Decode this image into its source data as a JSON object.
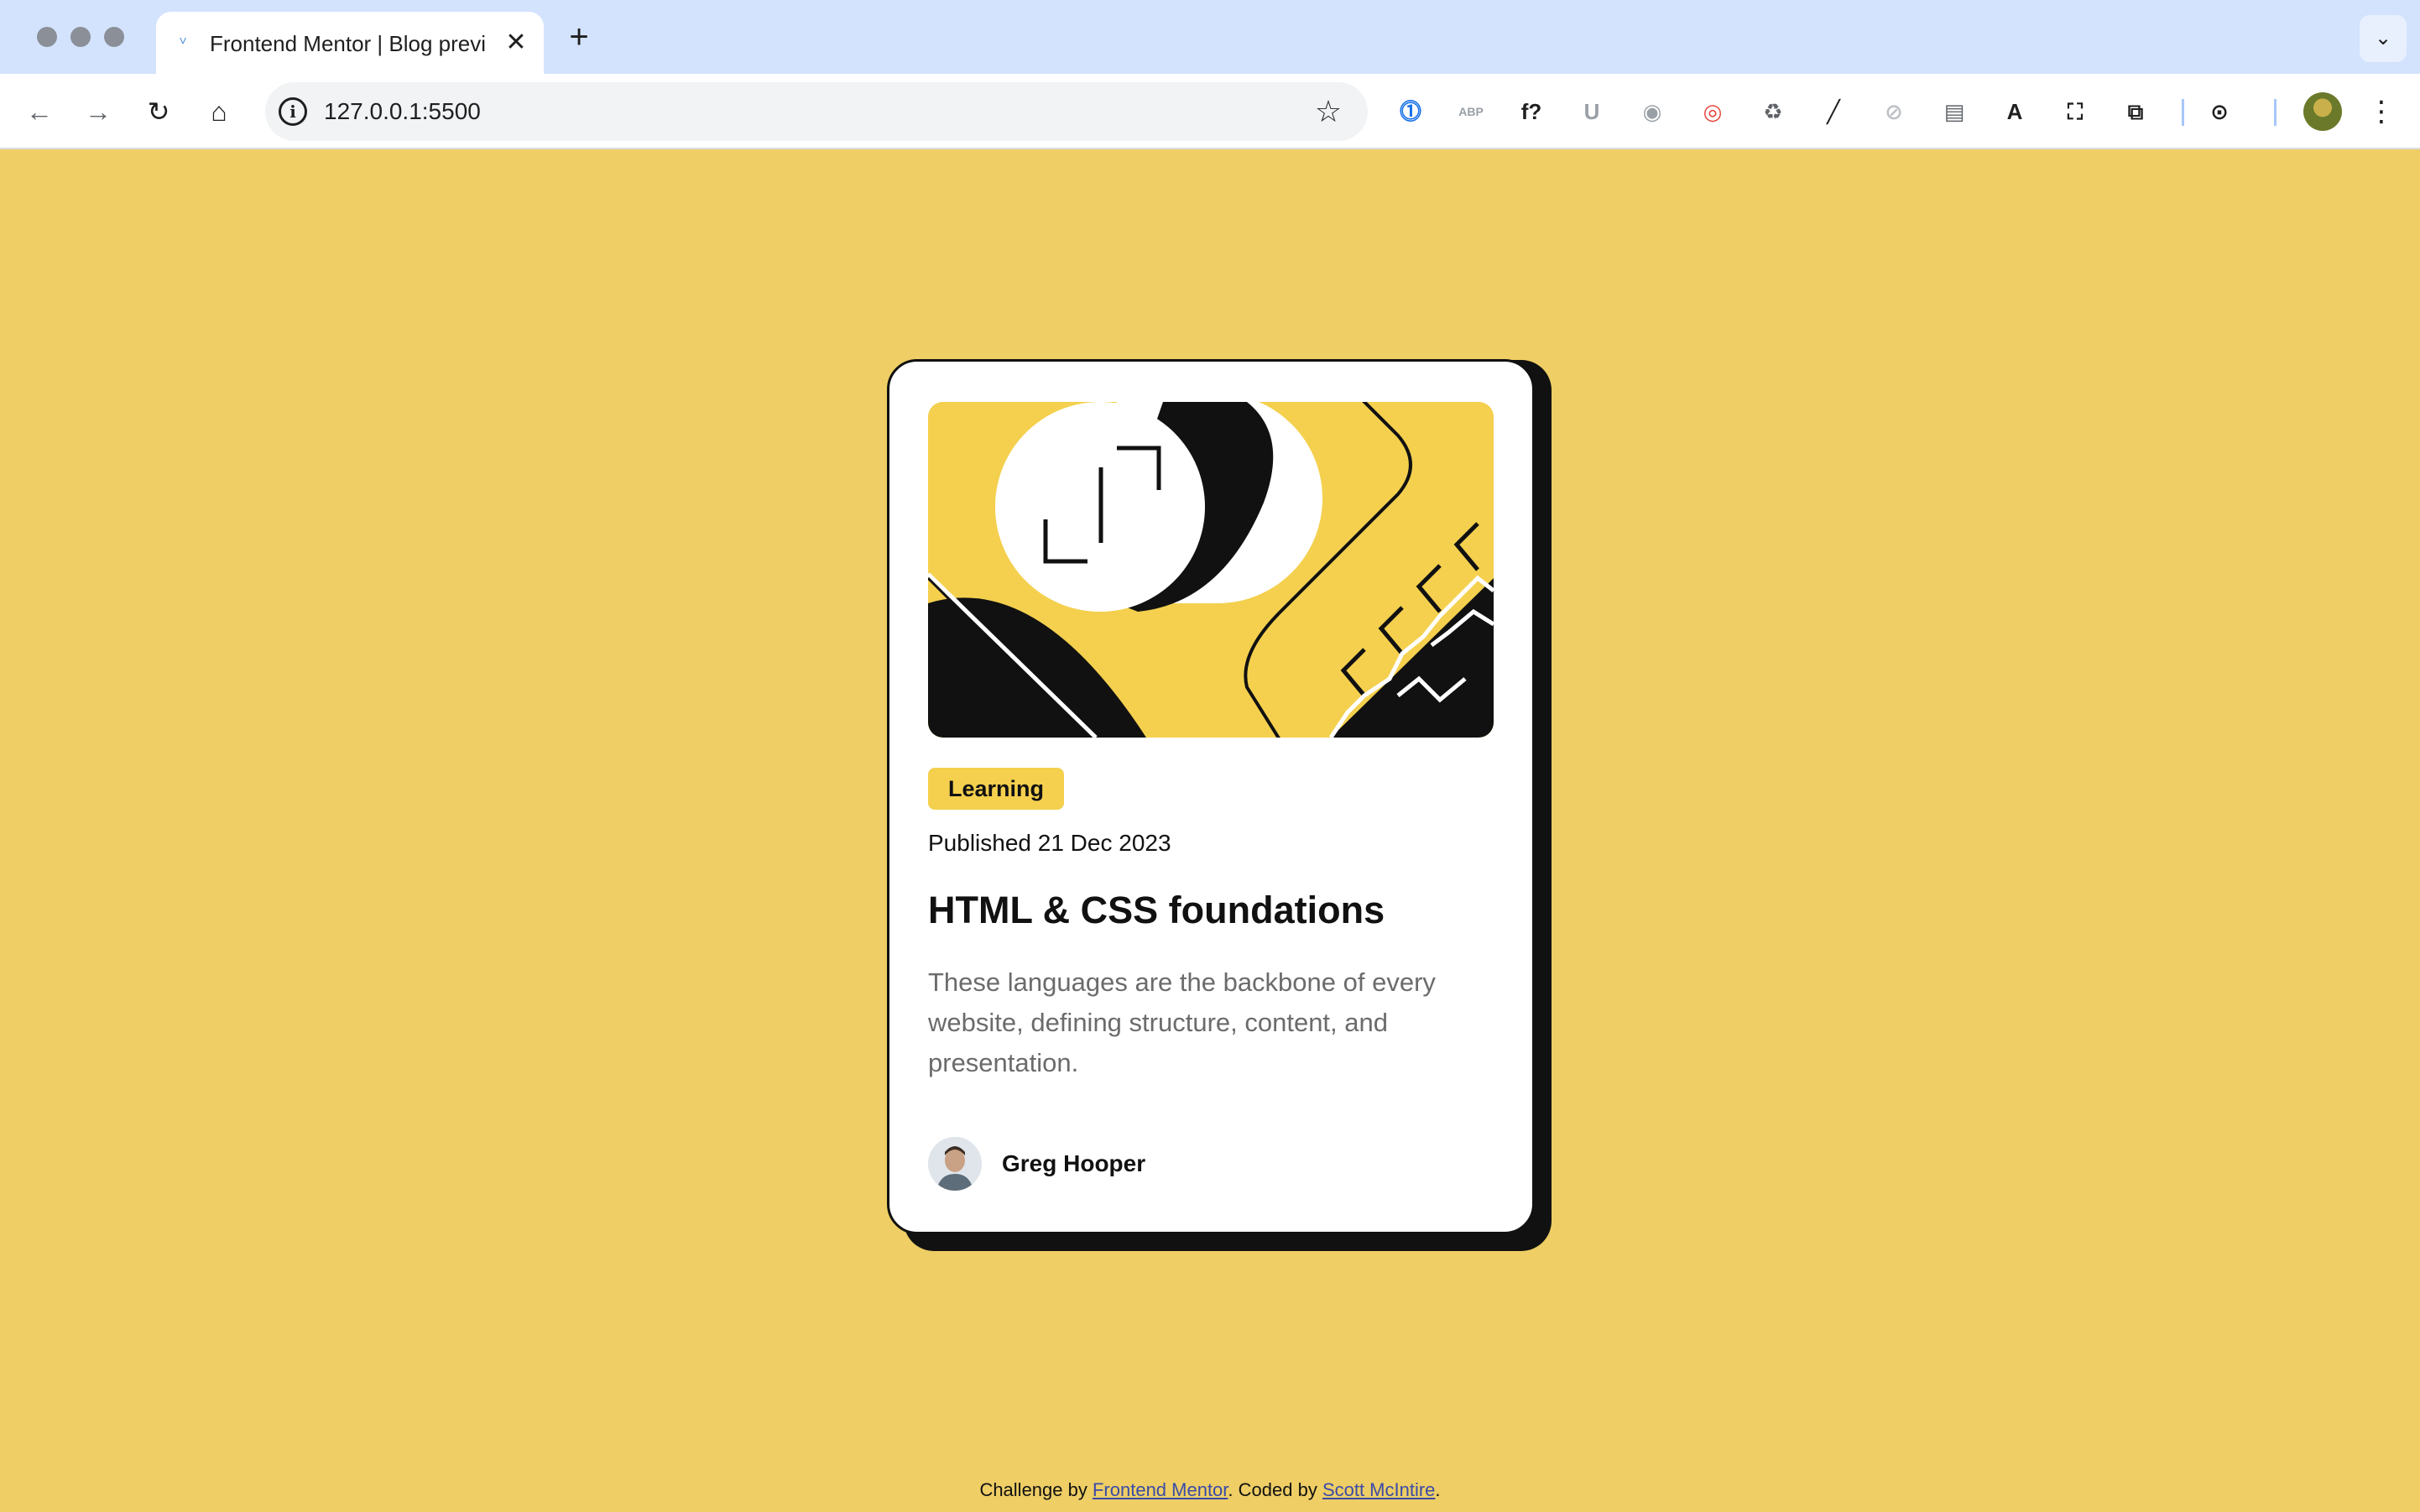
{
  "browser": {
    "tab_title": "Frontend Mentor | Blog preview",
    "url": "127.0.0.1:5500",
    "new_tab_label": "+",
    "extensions": [
      {
        "name": "password-manager-icon",
        "color": "#1a73e8",
        "glyph": "⓵"
      },
      {
        "name": "adblock-icon",
        "color": "#9aa0a6",
        "glyph": "ABP"
      },
      {
        "name": "font-ninja-icon",
        "color": "#1f1f1f",
        "glyph": "f?"
      },
      {
        "name": "shield-icon",
        "color": "#9aa0a6",
        "glyph": "U"
      },
      {
        "name": "camera-icon",
        "color": "#9aa0a6",
        "glyph": "◉"
      },
      {
        "name": "color-picker-icon",
        "color": "#e8453c",
        "glyph": "◎"
      },
      {
        "name": "recycle-icon",
        "color": "#5f6368",
        "glyph": "♻"
      },
      {
        "name": "eyedropper-icon",
        "color": "#1f1f1f",
        "glyph": "╱"
      },
      {
        "name": "compass-icon",
        "color": "#bdc1c6",
        "glyph": "⊘"
      },
      {
        "name": "notes-icon",
        "color": "#5f6368",
        "glyph": "▤"
      },
      {
        "name": "dark-circle-icon",
        "color": "#1f1f1f",
        "glyph": "A"
      },
      {
        "name": "screenshot-icon",
        "color": "#1f1f1f",
        "glyph": "⛶"
      },
      {
        "name": "puzzle-icon",
        "color": "#1f1f1f",
        "glyph": "⧉"
      },
      {
        "name": "lens-icon",
        "color": "#1f1f1f",
        "glyph": "⊙"
      }
    ]
  },
  "card": {
    "tag": "Learning",
    "published": "Published 21 Dec 2023",
    "title": "HTML & CSS foundations",
    "description": "These languages are the backbone of every website, defining structure, content, and presentation.",
    "author": "Greg Hooper"
  },
  "footer": {
    "prefix": "Challenge by ",
    "link1": "Frontend Mentor",
    "middle": ". Coded by ",
    "link2": "Scott McIntire",
    "suffix": "."
  },
  "colors": {
    "page_bg": "#eece65",
    "accent_yellow": "#f4d04e",
    "card_text": "#111111",
    "muted_text": "#6b6b6b"
  }
}
